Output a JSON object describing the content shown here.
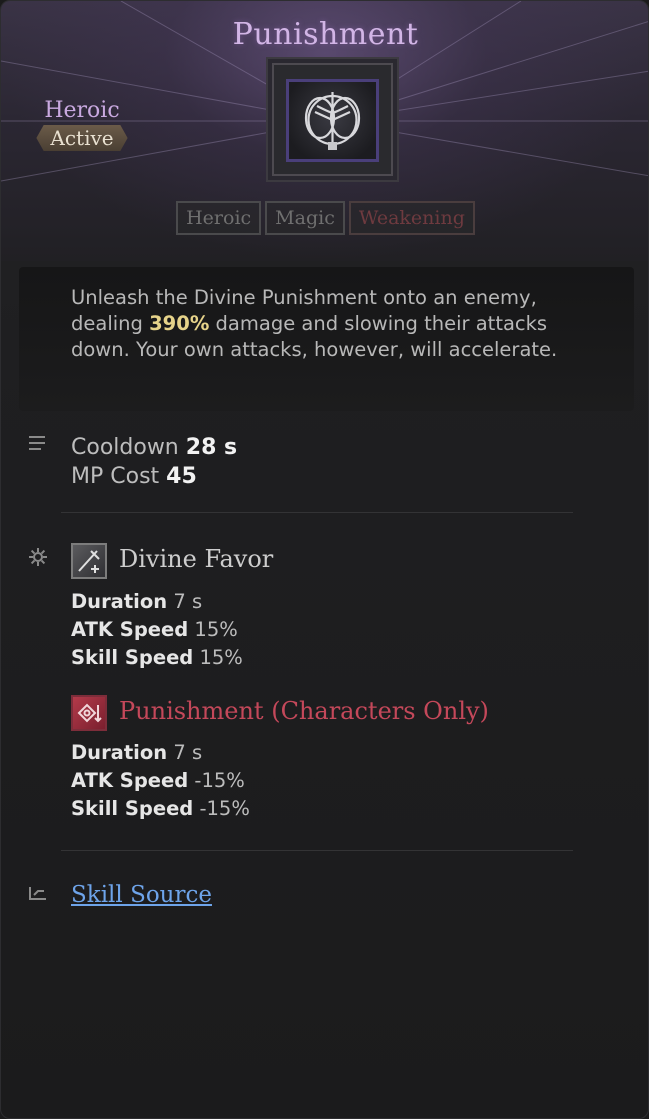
{
  "skill": {
    "title": "Punishment",
    "grade": "Heroic",
    "type": "Active",
    "icon": "winged-emblem-icon",
    "tags": [
      "Heroic",
      "Magic",
      "Weakening"
    ]
  },
  "description": {
    "part1": "Unleash the Divine Punishment onto an enemy, dealing ",
    "highlight": "390%",
    "part2": " damage and slowing their attacks down. Your own attacks, however, will accelerate."
  },
  "stats": {
    "cooldown_label": "Cooldown",
    "cooldown_value": "28 s",
    "mp_label": "MP Cost",
    "mp_value": "45"
  },
  "effects": [
    {
      "title": "Divine Favor",
      "icon": "sword-buff-icon",
      "rows": [
        {
          "label": "Duration",
          "value": "7 s"
        },
        {
          "label": "ATK Speed",
          "value": "15%"
        },
        {
          "label": "Skill Speed",
          "value": "15%"
        }
      ]
    },
    {
      "title": "Punishment (Characters Only)",
      "icon": "debuff-mark-icon",
      "rows": [
        {
          "label": "Duration",
          "value": "7 s"
        },
        {
          "label": "ATK Speed",
          "value": "-15%"
        },
        {
          "label": "Skill Speed",
          "value": "-15%"
        }
      ]
    }
  ],
  "source_link": "Skill Source",
  "colors": {
    "title": "#d2b5e6",
    "highlight": "#e6d38a",
    "debuff": "#c4485a",
    "link": "#6ea4ea"
  }
}
